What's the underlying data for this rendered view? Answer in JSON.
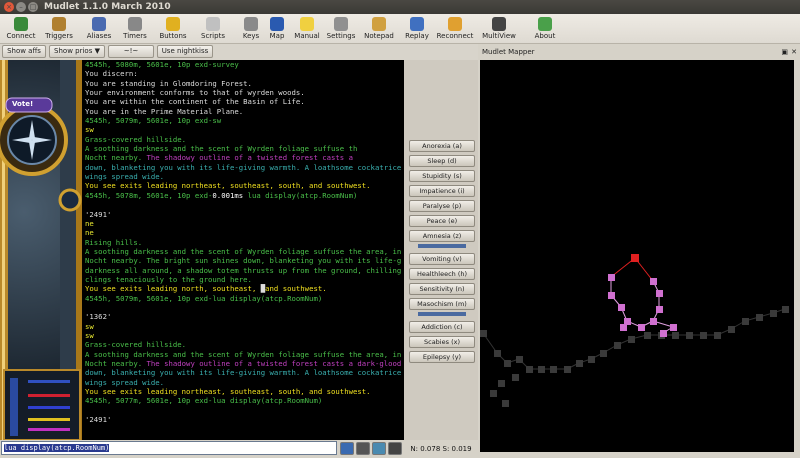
{
  "window": {
    "title": "Mudlet 1.1.0 March 2010"
  },
  "toolbar": [
    {
      "label": "Connect",
      "icon": "connect-icon"
    },
    {
      "label": "Triggers",
      "icon": "triggers-icon"
    },
    {
      "label": "Aliases",
      "icon": "aliases-icon"
    },
    {
      "label": "Timers",
      "icon": "timers-icon"
    },
    {
      "label": "Buttons",
      "icon": "buttons-icon"
    },
    {
      "label": "Scripts",
      "icon": "scripts-icon"
    },
    {
      "label": "Keys",
      "icon": "keys-icon"
    },
    {
      "label": "Map",
      "icon": "map-icon"
    },
    {
      "label": "Manual",
      "icon": "manual-icon"
    },
    {
      "label": "Settings",
      "icon": "settings-icon"
    },
    {
      "label": "Notepad",
      "icon": "notepad-icon"
    },
    {
      "label": "Replay",
      "icon": "replay-icon"
    },
    {
      "label": "Reconnect",
      "icon": "reconnect-icon"
    },
    {
      "label": "MultiView",
      "icon": "multiview-icon"
    },
    {
      "label": "About",
      "icon": "about-icon"
    }
  ],
  "subbar": {
    "show_affs": "Show affs",
    "show_prios": "Show prios",
    "arrow": "~!~",
    "nightkiss": "Use nightkiss"
  },
  "vote_label": "Vote!",
  "console_lines": [
    [
      {
        "t": "4545h, 5080m, 5601e, 10p exd-survey",
        "c": "#4ac04a"
      }
    ],
    [
      {
        "t": "You discern:",
        "c": "#ddd"
      }
    ],
    [
      {
        "t": "You are standing in Glomdoring Forest.",
        "c": "#ddd"
      }
    ],
    [
      {
        "t": "Your environment conforms to that of wyrden woods.",
        "c": "#ddd"
      }
    ],
    [
      {
        "t": "You are within the continent of the Basin of Life.",
        "c": "#ddd"
      }
    ],
    [
      {
        "t": "You are in the Prime Material Plane.",
        "c": "#ddd"
      }
    ],
    [
      {
        "t": "4545h, 5079m, 5601e, 10p exd-sw",
        "c": "#4ac04a"
      }
    ],
    [
      {
        "t": "sw",
        "c": "#e8e830"
      }
    ],
    [
      {
        "t": "Grass-covered hillside.",
        "c": "#4ac04a"
      }
    ],
    [
      {
        "t": "A soothing darkness and the scent of Wyrden foliage suffuse th",
        "c": "#4ac04a"
      }
    ],
    [
      {
        "t": "Nocht nearby. ",
        "c": "#4ac04a"
      },
      {
        "t": "The shadowy outline of a twisted forest casts a",
        "c": "#c040c0"
      }
    ],
    [
      {
        "t": "down, blanketing you with its life-giving warmth. A loathsome cockatrice",
        "c": "#3ab0b0"
      }
    ],
    [
      {
        "t": "wings spread wide.",
        "c": "#3ab0b0"
      }
    ],
    [
      {
        "t": "You see exits leading northeast, southeast, south, and southwest.",
        "c": "#f0e020"
      }
    ],
    [
      {
        "t": "4545h, 5078m, 5601e, 10p exd-",
        "c": "#4ac04a"
      },
      {
        "t": "0.001ms",
        "c": "#fff"
      },
      {
        "t": " lua display(atcp.RoomNum)",
        "c": "#4ac04a"
      }
    ],
    [
      {
        "t": "",
        "c": "#ddd"
      }
    ],
    [
      {
        "t": "'2491'",
        "c": "#ddd"
      }
    ],
    [
      {
        "t": "ne",
        "c": "#e8e830"
      }
    ],
    [
      {
        "t": "ne",
        "c": "#e8e830"
      }
    ],
    [
      {
        "t": "Rising hills.",
        "c": "#4ac04a"
      }
    ],
    [
      {
        "t": "A soothing darkness and the scent of Wyrden foliage suffuse the area, in",
        "c": "#4ac04a"
      }
    ],
    [
      {
        "t": "Nocht nearby. The bright sun shines down, blanketing you with its life-g",
        "c": "#4ac04a"
      }
    ],
    [
      {
        "t": "darkness all around, a shadow totem thrusts up from the ground, chilling",
        "c": "#4ac04a"
      }
    ],
    [
      {
        "t": "clings tenaciously to the ground here.",
        "c": "#4ac04a"
      }
    ],
    [
      {
        "t": "You see exits leading north, southeast, ",
        "c": "#f0e020"
      },
      {
        "t": "█",
        "c": "#ddd"
      },
      {
        "t": "and southwest.",
        "c": "#f0e020"
      }
    ],
    [
      {
        "t": "4545h, 5079m, 5601e, 10p exd-lua display(atcp.RoomNum)",
        "c": "#4ac04a"
      }
    ],
    [
      {
        "t": "",
        "c": "#ddd"
      }
    ],
    [
      {
        "t": "'1362'",
        "c": "#ddd"
      }
    ],
    [
      {
        "t": "sw",
        "c": "#e8e830"
      }
    ],
    [
      {
        "t": "sw",
        "c": "#e8e830"
      }
    ],
    [
      {
        "t": "Grass-covered hillside.",
        "c": "#4ac04a"
      }
    ],
    [
      {
        "t": "A soothing darkness and the scent of Wyrden foliage suffuse the area, in",
        "c": "#4ac04a"
      }
    ],
    [
      {
        "t": "Nocht nearby. ",
        "c": "#4ac04a"
      },
      {
        "t": "The shadowy outline of a twisted forest casts a dark-glood",
        "c": "#c040c0"
      }
    ],
    [
      {
        "t": "down, blanketing you with its life-giving warmth. A loathsome cockatrice",
        "c": "#3ab0b0"
      }
    ],
    [
      {
        "t": "wings spread wide.",
        "c": "#3ab0b0"
      }
    ],
    [
      {
        "t": "You see exits leading northeast, southeast, south, and southwest.",
        "c": "#f0e020"
      }
    ],
    [
      {
        "t": "4545h, 5077m, 5601e, 10p exd-lua display(atcp.RoomNum)",
        "c": "#4ac04a"
      }
    ],
    [
      {
        "t": "",
        "c": "#ddd"
      }
    ],
    [
      {
        "t": "'2491'",
        "c": "#ddd"
      }
    ]
  ],
  "afflictions": [
    "Anorexia (a)",
    "Sleep (d)",
    "Stupidity (s)",
    "Impatience (i)",
    "Paralyse (p)",
    "Peace (e)",
    "Amnesia (z)",
    "Vomiting (v)",
    "Healthleech (h)",
    "Sensitivity (n)",
    "Masochism (m)",
    "Addiction (c)",
    "Scabies (x)",
    "Epilepsy (y)"
  ],
  "mapper": {
    "title": "Mudlet Mapper",
    "room_color": "#d070d0",
    "current_room_color": "#e02020",
    "exit_color": "#e0a0e0",
    "other_room_color": "#3a3a3a"
  },
  "command": {
    "value": "lua display(atcp.RoomNum)"
  },
  "netstat": "N: 0.078  S: 0.019",
  "colors": {
    "console_bg": "#000000",
    "prompt": "#4ac04a",
    "exits": "#f0e020",
    "panel_gold": "#c99a2c"
  }
}
